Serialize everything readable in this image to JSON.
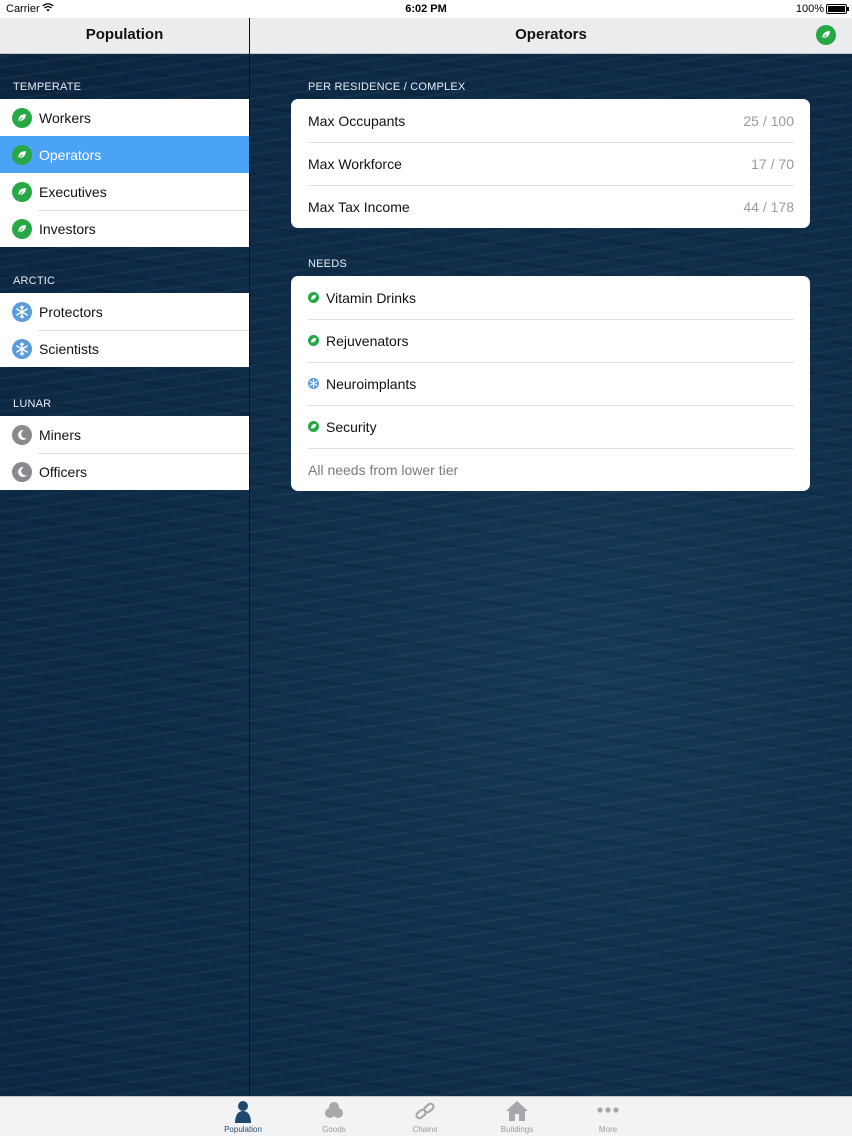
{
  "status_bar": {
    "carrier": "Carrier",
    "time": "6:02 PM",
    "battery": "100%"
  },
  "sidebar": {
    "title": "Population",
    "sections": [
      {
        "header": "TEMPERATE",
        "icon": "leaf-icon",
        "items": [
          {
            "label": "Workers"
          },
          {
            "label": "Operators"
          },
          {
            "label": "Executives"
          },
          {
            "label": "Investors"
          }
        ]
      },
      {
        "header": "ARCTIC",
        "icon": "snowflake-icon",
        "items": [
          {
            "label": "Protectors"
          },
          {
            "label": "Scientists"
          }
        ]
      },
      {
        "header": "LUNAR",
        "icon": "moon-icon",
        "items": [
          {
            "label": "Miners"
          },
          {
            "label": "Officers"
          }
        ]
      }
    ],
    "selected": "Operators"
  },
  "detail": {
    "title": "Operators",
    "title_icon": "leaf-icon",
    "residence": {
      "header": "PER RESIDENCE / COMPLEX",
      "rows": [
        {
          "label": "Max Occupants",
          "value": "25 / 100"
        },
        {
          "label": "Max Workforce",
          "value": "17 / 70"
        },
        {
          "label": "Max Tax Income",
          "value": "44 / 178"
        }
      ]
    },
    "needs": {
      "header": "NEEDS",
      "items": [
        {
          "label": "Vitamin Drinks",
          "icon": "leaf-icon"
        },
        {
          "label": "Rejuvenators",
          "icon": "leaf-icon"
        },
        {
          "label": "Neuroimplants",
          "icon": "snowflake-icon"
        },
        {
          "label": "Security",
          "icon": "leaf-icon"
        }
      ],
      "footnote": "All needs from lower tier"
    }
  },
  "tab_bar": {
    "tabs": [
      {
        "label": "Population",
        "icon": "person-icon",
        "active": true
      },
      {
        "label": "Goods",
        "icon": "goods-icon",
        "active": false
      },
      {
        "label": "Chains",
        "icon": "chain-link-icon",
        "active": false
      },
      {
        "label": "Buildings",
        "icon": "house-icon",
        "active": false
      },
      {
        "label": "More",
        "icon": "more-dots-icon",
        "active": false
      }
    ]
  },
  "colors": {
    "temperate": "#27a845",
    "arctic": "#5b9cd8",
    "lunar": "#8a8a8e",
    "selection": "#4aa3f5",
    "active_tab": "#1f4a6e"
  }
}
